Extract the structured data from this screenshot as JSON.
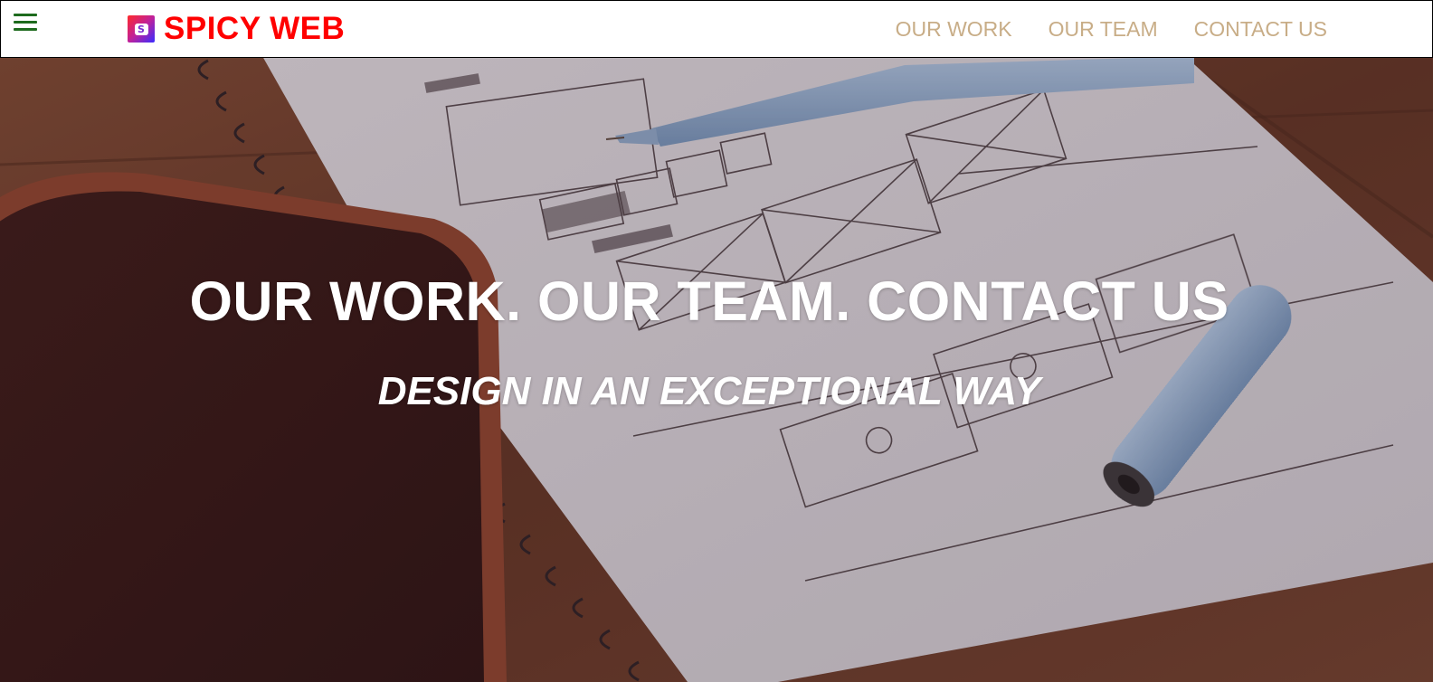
{
  "nav": {
    "brand_icon_letter": "S",
    "brand_name": "SPICY WEB",
    "links": [
      "OUR WORK",
      "OUR TEAM",
      "CONTACT US"
    ]
  },
  "hero": {
    "title": "OUR WORK. OUR TEAM. CONTACT US",
    "subtitle": "DESIGN IN AN EXCEPTIONAL WAY"
  },
  "icons": {
    "menu": "hamburger-menu-icon",
    "brand": "spicy-web-logo-icon"
  },
  "colors": {
    "brand": "#ff0000",
    "nav_link": "#c8ad87",
    "menu_icon": "#1e6b1e",
    "hero_text": "#ffffff"
  }
}
